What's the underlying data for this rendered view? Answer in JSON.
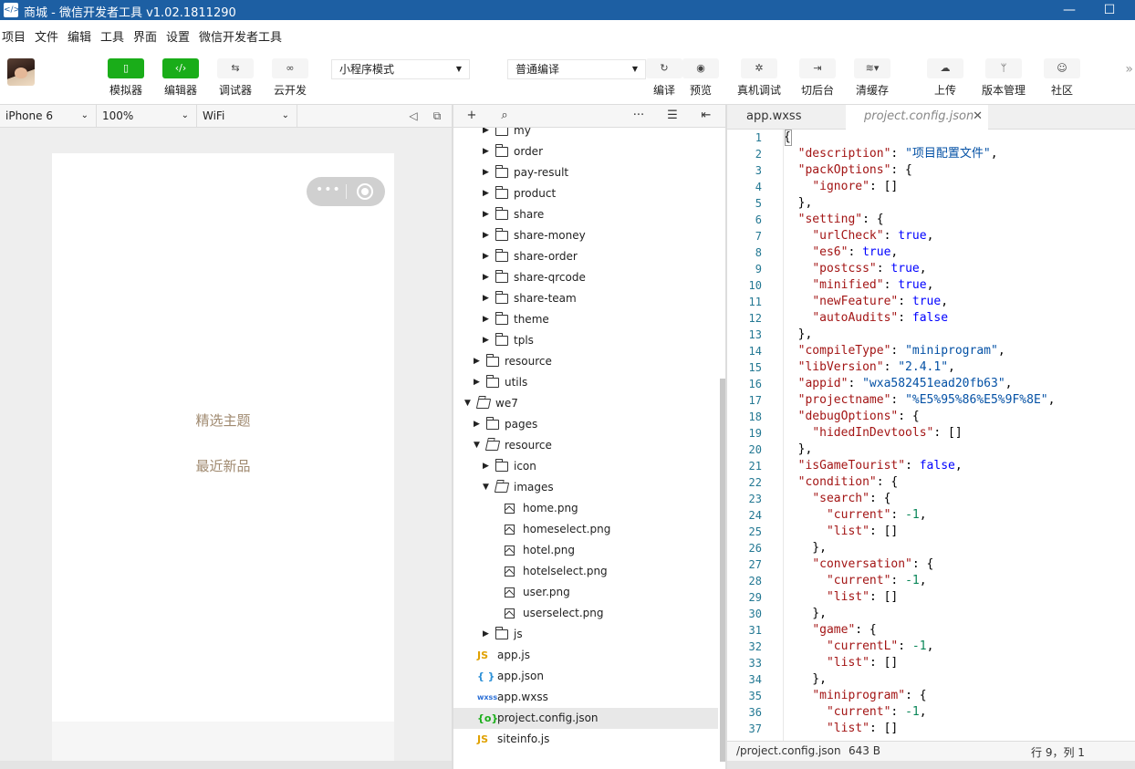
{
  "window": {
    "title": "商城 - 微信开发者工具 v1.02.1811290",
    "app_icon": "</>",
    "minimize": "—",
    "maximize": "☐"
  },
  "menu": [
    "项目",
    "文件",
    "编辑",
    "工具",
    "界面",
    "设置",
    "微信开发者工具"
  ],
  "toolbar": {
    "left_tools": [
      {
        "label": "模拟器",
        "icon": "phone-icon",
        "active": true
      },
      {
        "label": "编辑器",
        "icon": "code-icon",
        "active": true
      },
      {
        "label": "调试器",
        "icon": "debug-icon",
        "active": false
      },
      {
        "label": "云开发",
        "icon": "cloud-link-icon",
        "active": false
      }
    ],
    "mode_select": "小程序模式",
    "compile_select": "普通编译",
    "right_tools": [
      {
        "label": "编译",
        "icon": "refresh-icon"
      },
      {
        "label": "预览",
        "icon": "eye-icon"
      },
      {
        "label": "真机调试",
        "icon": "bug-icon"
      },
      {
        "label": "切后台",
        "icon": "background-icon"
      },
      {
        "label": "清缓存",
        "icon": "layers-icon"
      },
      {
        "label": "上传",
        "icon": "upload-icon"
      },
      {
        "label": "版本管理",
        "icon": "git-icon"
      },
      {
        "label": "社区",
        "icon": "community-icon"
      }
    ],
    "more": "»"
  },
  "simulator": {
    "device": "iPhone 6",
    "zoom": "100%",
    "network": "WiFi",
    "texts": [
      "精选主题",
      "最近新品"
    ]
  },
  "filetree": {
    "rows": [
      {
        "name": "my",
        "type": "folder",
        "depth": 2,
        "open": false
      },
      {
        "name": "order",
        "type": "folder",
        "depth": 2,
        "open": false
      },
      {
        "name": "pay-result",
        "type": "folder",
        "depth": 2,
        "open": false
      },
      {
        "name": "product",
        "type": "folder",
        "depth": 2,
        "open": false
      },
      {
        "name": "share",
        "type": "folder",
        "depth": 2,
        "open": false
      },
      {
        "name": "share-money",
        "type": "folder",
        "depth": 2,
        "open": false
      },
      {
        "name": "share-order",
        "type": "folder",
        "depth": 2,
        "open": false
      },
      {
        "name": "share-qrcode",
        "type": "folder",
        "depth": 2,
        "open": false
      },
      {
        "name": "share-team",
        "type": "folder",
        "depth": 2,
        "open": false
      },
      {
        "name": "theme",
        "type": "folder",
        "depth": 2,
        "open": false
      },
      {
        "name": "tpls",
        "type": "folder",
        "depth": 2,
        "open": false
      },
      {
        "name": "resource",
        "type": "folder",
        "depth": 1,
        "open": false
      },
      {
        "name": "utils",
        "type": "folder",
        "depth": 1,
        "open": false
      },
      {
        "name": "we7",
        "type": "folder",
        "depth": 0,
        "open": true
      },
      {
        "name": "pages",
        "type": "folder",
        "depth": 1,
        "open": false
      },
      {
        "name": "resource",
        "type": "folder",
        "depth": 1,
        "open": true
      },
      {
        "name": "icon",
        "type": "folder",
        "depth": 2,
        "open": false
      },
      {
        "name": "images",
        "type": "folder",
        "depth": 2,
        "open": true
      },
      {
        "name": "home.png",
        "type": "image",
        "depth": 3
      },
      {
        "name": "homeselect.png",
        "type": "image",
        "depth": 3
      },
      {
        "name": "hotel.png",
        "type": "image",
        "depth": 3
      },
      {
        "name": "hotelselect.png",
        "type": "image",
        "depth": 3
      },
      {
        "name": "user.png",
        "type": "image",
        "depth": 3
      },
      {
        "name": "userselect.png",
        "type": "image",
        "depth": 3
      },
      {
        "name": "js",
        "type": "folder",
        "depth": 2,
        "open": false
      },
      {
        "name": "app.js",
        "type": "js",
        "depth": 0,
        "tag": "JS"
      },
      {
        "name": "app.json",
        "type": "json",
        "depth": 0,
        "tag": "{ }"
      },
      {
        "name": "app.wxss",
        "type": "wxss",
        "depth": 0,
        "tag": "wxss"
      },
      {
        "name": "project.config.json",
        "type": "config",
        "depth": 0,
        "tag": "{o}",
        "selected": true
      },
      {
        "name": "siteinfo.js",
        "type": "js",
        "depth": 0,
        "tag": "JS"
      }
    ]
  },
  "editor": {
    "tabs": [
      {
        "label": "app.wxss",
        "active": false
      },
      {
        "label": "project.config.json",
        "active": true,
        "close": "✕"
      }
    ],
    "lines": [
      [
        {
          "t": "{",
          "c": ""
        }
      ],
      [
        {
          "t": "  ",
          "c": ""
        },
        {
          "t": "\"description\"",
          "c": "k"
        },
        {
          "t": ": ",
          "c": ""
        },
        {
          "t": "\"项目配置文件\"",
          "c": "s"
        },
        {
          "t": ",",
          "c": ""
        }
      ],
      [
        {
          "t": "  ",
          "c": ""
        },
        {
          "t": "\"packOptions\"",
          "c": "k"
        },
        {
          "t": ": {",
          "c": ""
        }
      ],
      [
        {
          "t": "    ",
          "c": ""
        },
        {
          "t": "\"ignore\"",
          "c": "k"
        },
        {
          "t": ": []",
          "c": ""
        }
      ],
      [
        {
          "t": "  },",
          "c": ""
        }
      ],
      [
        {
          "t": "  ",
          "c": ""
        },
        {
          "t": "\"setting\"",
          "c": "k"
        },
        {
          "t": ": {",
          "c": ""
        }
      ],
      [
        {
          "t": "    ",
          "c": ""
        },
        {
          "t": "\"urlCheck\"",
          "c": "k"
        },
        {
          "t": ": ",
          "c": ""
        },
        {
          "t": "true",
          "c": "b"
        },
        {
          "t": ",",
          "c": ""
        }
      ],
      [
        {
          "t": "    ",
          "c": ""
        },
        {
          "t": "\"es6\"",
          "c": "k"
        },
        {
          "t": ": ",
          "c": ""
        },
        {
          "t": "true",
          "c": "b"
        },
        {
          "t": ",",
          "c": ""
        }
      ],
      [
        {
          "t": "    ",
          "c": ""
        },
        {
          "t": "\"postcss\"",
          "c": "k"
        },
        {
          "t": ": ",
          "c": ""
        },
        {
          "t": "true",
          "c": "b"
        },
        {
          "t": ",",
          "c": ""
        }
      ],
      [
        {
          "t": "    ",
          "c": ""
        },
        {
          "t": "\"minified\"",
          "c": "k"
        },
        {
          "t": ": ",
          "c": ""
        },
        {
          "t": "true",
          "c": "b"
        },
        {
          "t": ",",
          "c": ""
        }
      ],
      [
        {
          "t": "    ",
          "c": ""
        },
        {
          "t": "\"newFeature\"",
          "c": "k"
        },
        {
          "t": ": ",
          "c": ""
        },
        {
          "t": "true",
          "c": "b"
        },
        {
          "t": ",",
          "c": ""
        }
      ],
      [
        {
          "t": "    ",
          "c": ""
        },
        {
          "t": "\"autoAudits\"",
          "c": "k"
        },
        {
          "t": ": ",
          "c": ""
        },
        {
          "t": "false",
          "c": "b"
        }
      ],
      [
        {
          "t": "  },",
          "c": ""
        }
      ],
      [
        {
          "t": "  ",
          "c": ""
        },
        {
          "t": "\"compileType\"",
          "c": "k"
        },
        {
          "t": ": ",
          "c": ""
        },
        {
          "t": "\"miniprogram\"",
          "c": "s"
        },
        {
          "t": ",",
          "c": ""
        }
      ],
      [
        {
          "t": "  ",
          "c": ""
        },
        {
          "t": "\"libVersion\"",
          "c": "k"
        },
        {
          "t": ": ",
          "c": ""
        },
        {
          "t": "\"2.4.1\"",
          "c": "s"
        },
        {
          "t": ",",
          "c": ""
        }
      ],
      [
        {
          "t": "  ",
          "c": ""
        },
        {
          "t": "\"appid\"",
          "c": "k"
        },
        {
          "t": ": ",
          "c": ""
        },
        {
          "t": "\"wxa582451ead20fb63\"",
          "c": "s"
        },
        {
          "t": ",",
          "c": ""
        }
      ],
      [
        {
          "t": "  ",
          "c": ""
        },
        {
          "t": "\"projectname\"",
          "c": "k"
        },
        {
          "t": ": ",
          "c": ""
        },
        {
          "t": "\"%E5%95%86%E5%9F%8E\"",
          "c": "s"
        },
        {
          "t": ",",
          "c": ""
        }
      ],
      [
        {
          "t": "  ",
          "c": ""
        },
        {
          "t": "\"debugOptions\"",
          "c": "k"
        },
        {
          "t": ": {",
          "c": ""
        }
      ],
      [
        {
          "t": "    ",
          "c": ""
        },
        {
          "t": "\"hidedInDevtools\"",
          "c": "k"
        },
        {
          "t": ": []",
          "c": ""
        }
      ],
      [
        {
          "t": "  },",
          "c": ""
        }
      ],
      [
        {
          "t": "  ",
          "c": ""
        },
        {
          "t": "\"isGameTourist\"",
          "c": "k"
        },
        {
          "t": ": ",
          "c": ""
        },
        {
          "t": "false",
          "c": "b"
        },
        {
          "t": ",",
          "c": ""
        }
      ],
      [
        {
          "t": "  ",
          "c": ""
        },
        {
          "t": "\"condition\"",
          "c": "k"
        },
        {
          "t": ": {",
          "c": ""
        }
      ],
      [
        {
          "t": "    ",
          "c": ""
        },
        {
          "t": "\"search\"",
          "c": "k"
        },
        {
          "t": ": {",
          "c": ""
        }
      ],
      [
        {
          "t": "      ",
          "c": ""
        },
        {
          "t": "\"current\"",
          "c": "k"
        },
        {
          "t": ": ",
          "c": ""
        },
        {
          "t": "-1",
          "c": "n"
        },
        {
          "t": ",",
          "c": ""
        }
      ],
      [
        {
          "t": "      ",
          "c": ""
        },
        {
          "t": "\"list\"",
          "c": "k"
        },
        {
          "t": ": []",
          "c": ""
        }
      ],
      [
        {
          "t": "    },",
          "c": ""
        }
      ],
      [
        {
          "t": "    ",
          "c": ""
        },
        {
          "t": "\"conversation\"",
          "c": "k"
        },
        {
          "t": ": {",
          "c": ""
        }
      ],
      [
        {
          "t": "      ",
          "c": ""
        },
        {
          "t": "\"current\"",
          "c": "k"
        },
        {
          "t": ": ",
          "c": ""
        },
        {
          "t": "-1",
          "c": "n"
        },
        {
          "t": ",",
          "c": ""
        }
      ],
      [
        {
          "t": "      ",
          "c": ""
        },
        {
          "t": "\"list\"",
          "c": "k"
        },
        {
          "t": ": []",
          "c": ""
        }
      ],
      [
        {
          "t": "    },",
          "c": ""
        }
      ],
      [
        {
          "t": "    ",
          "c": ""
        },
        {
          "t": "\"game\"",
          "c": "k"
        },
        {
          "t": ": {",
          "c": ""
        }
      ],
      [
        {
          "t": "      ",
          "c": ""
        },
        {
          "t": "\"currentL\"",
          "c": "k"
        },
        {
          "t": ": ",
          "c": ""
        },
        {
          "t": "-1",
          "c": "n"
        },
        {
          "t": ",",
          "c": ""
        }
      ],
      [
        {
          "t": "      ",
          "c": ""
        },
        {
          "t": "\"list\"",
          "c": "k"
        },
        {
          "t": ": []",
          "c": ""
        }
      ],
      [
        {
          "t": "    },",
          "c": ""
        }
      ],
      [
        {
          "t": "    ",
          "c": ""
        },
        {
          "t": "\"miniprogram\"",
          "c": "k"
        },
        {
          "t": ": {",
          "c": ""
        }
      ],
      [
        {
          "t": "      ",
          "c": ""
        },
        {
          "t": "\"current\"",
          "c": "k"
        },
        {
          "t": ": ",
          "c": ""
        },
        {
          "t": "-1",
          "c": "n"
        },
        {
          "t": ",",
          "c": ""
        }
      ],
      [
        {
          "t": "      ",
          "c": ""
        },
        {
          "t": "\"list\"",
          "c": "k"
        },
        {
          "t": ": []",
          "c": ""
        }
      ]
    ]
  },
  "status": {
    "path": "/project.config.json",
    "size": "643 B",
    "position": "行 9，列 1"
  },
  "colors": {
    "titlebar": "#1d5fa3",
    "green": "#1aad19",
    "key": "#a31515",
    "string": "#0451a5",
    "bool": "#0000ff",
    "number": "#098658"
  }
}
